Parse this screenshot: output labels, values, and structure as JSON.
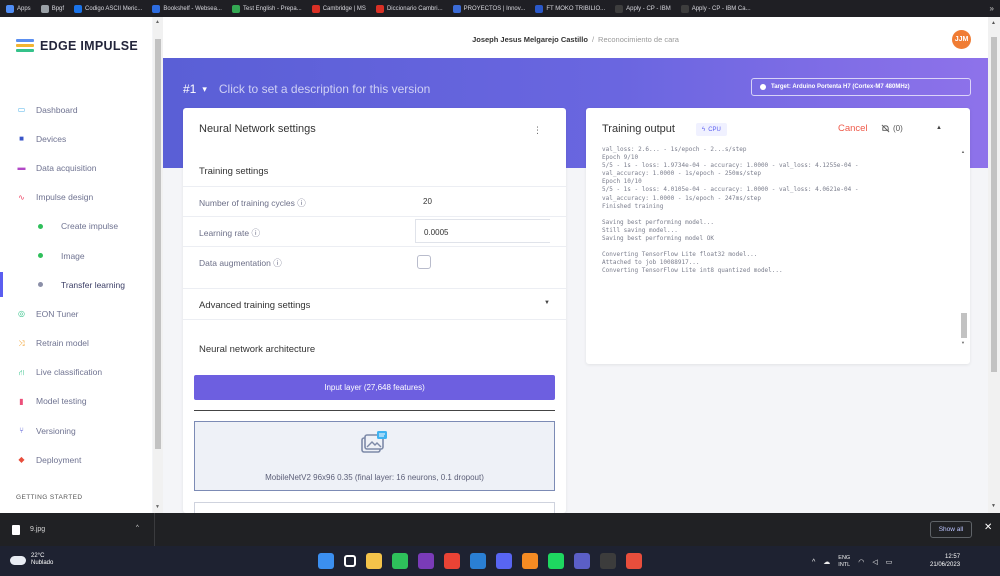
{
  "bookmarks": [
    {
      "label": "Apps",
      "color": "#4f8df5"
    },
    {
      "label": "Bpgf",
      "color": "#9aa0a6"
    },
    {
      "label": "Codigo ASCII Meric...",
      "color": "#1a73e8"
    },
    {
      "label": "Bookshelf - Websea...",
      "color": "#2d6cdf"
    },
    {
      "label": "Test English - Prepa...",
      "color": "#34a853"
    },
    {
      "label": "Cambridge | MS",
      "color": "#d93025"
    },
    {
      "label": "Diccionario Cambri...",
      "color": "#d93025"
    },
    {
      "label": "PROYECTOS | Innov...",
      "color": "#3b6bd6"
    },
    {
      "label": "FT MOKO TRIBILIO...",
      "color": "#2a58c9"
    },
    {
      "label": "Apply - CP - IBM",
      "color": "#3d3d3d"
    },
    {
      "label": "Apply - CP - IBM Ca...",
      "color": "#3d3d3d"
    }
  ],
  "logo": {
    "text": "EDGE IMPULSE"
  },
  "nav": [
    {
      "label": "Dashboard",
      "icon": "monitor-icon",
      "color": "#4fb0e8",
      "glyph": "▭"
    },
    {
      "label": "Devices",
      "icon": "chip-icon",
      "color": "#3a55c8",
      "glyph": "■"
    },
    {
      "label": "Data acquisition",
      "icon": "database-icon",
      "color": "#b248c6",
      "glyph": "▬"
    },
    {
      "label": "Impulse design",
      "icon": "pulse-icon",
      "color": "#ef4a6a",
      "glyph": "∿"
    },
    {
      "label": "Create impulse",
      "sub": true,
      "dot": "#2fbf5b"
    },
    {
      "label": "Image",
      "sub": true,
      "dot": "#2fbf5b"
    },
    {
      "label": "Transfer learning",
      "sub": true,
      "dot": "#8b8fa8",
      "active": true
    },
    {
      "label": "EON Tuner",
      "icon": "tuner-icon",
      "color": "#35c28a",
      "glyph": "◎"
    },
    {
      "label": "Retrain model",
      "icon": "shuffle-icon",
      "color": "#f2a12e",
      "glyph": "⤨"
    },
    {
      "label": "Live classification",
      "icon": "tree-icon",
      "color": "#35c28a",
      "glyph": "⛙"
    },
    {
      "label": "Model testing",
      "icon": "flask-icon",
      "color": "#ec4f7a",
      "glyph": "▮"
    },
    {
      "label": "Versioning",
      "icon": "branch-icon",
      "color": "#5a5fd6",
      "glyph": "⑂"
    },
    {
      "label": "Deployment",
      "icon": "cube-icon",
      "color": "#e84e3c",
      "glyph": "◆"
    }
  ],
  "getting_started": "GETTING STARTED",
  "header": {
    "user": "Joseph Jesus Melgarejo Castillo",
    "separator": "/",
    "project": "Reconocimiento de cara",
    "avatar": "JJM"
  },
  "version": {
    "number": "#1",
    "caret": "▾",
    "description": "Click to set a description for this version"
  },
  "target": {
    "label": "Target: Arduino Portenta H7 (Cortex-M7 480MHz)"
  },
  "nn": {
    "title": "Neural Network settings",
    "menu": "⋮",
    "training_section": "Training settings",
    "cycles_label": "Number of training cycles ⓘ",
    "cycles_value": "20",
    "lr_label": "Learning rate ⓘ",
    "lr_value": "0.0005",
    "aug_label": "Data augmentation ⓘ",
    "aug_checked": false,
    "advanced": "Advanced training settings",
    "advanced_caret": "▼",
    "arch_section": "Neural network architecture",
    "input_layer": "Input layer (27,648 features)",
    "mobilenet": "MobileNetV2 96x96 0.35 (final layer: 16 neurons, 0.1 dropout)"
  },
  "training": {
    "title": "Training output",
    "cpu": "CPU",
    "cancel": "Cancel",
    "bell_count": "(0)",
    "caret": "▲",
    "log": [
      "val_loss: 2.6... - 1s/epoch - 2...s/step",
      "Epoch 9/10",
      "5/5 - 1s - loss: 1.9734e-04 - accuracy: 1.0000 - val_loss: 4.1255e-04 -",
      "val_accuracy: 1.0000 - 1s/epoch - 250ms/step",
      "Epoch 10/10",
      "5/5 - 1s - loss: 4.0105e-04 - accuracy: 1.0000 - val_loss: 4.0621e-04 -",
      "val_accuracy: 1.0000 - 1s/epoch - 247ms/step",
      "Finished training",
      "",
      "Saving best performing model...",
      "Still saving model...",
      "Saving best performing model OK",
      "",
      "Converting TensorFlow Lite float32 model...",
      "Attached to job 10088917...",
      "Converting TensorFlow Lite int8 quantized model..."
    ]
  },
  "downloads": {
    "file": "9.jpg",
    "caret": "^",
    "show_all": "Show all",
    "close": "✕"
  },
  "taskbar": {
    "temp": "22°C",
    "condition": "Nublado",
    "lang_top": "ENG",
    "lang_bottom": "INTL",
    "time": "12:57",
    "date": "21/06/2023"
  },
  "taskbar_apps": [
    {
      "name": "windows-start-icon",
      "color": "#3b8ff0"
    },
    {
      "name": "task-view-icon",
      "color": "#ffffff"
    },
    {
      "name": "file-explorer-icon",
      "color": "#f4c34a"
    },
    {
      "name": "whatsapp-icon",
      "color": "#2ec15b"
    },
    {
      "name": "onenote-icon",
      "color": "#7a3bb8"
    },
    {
      "name": "chrome-icon",
      "color": "#e94335"
    },
    {
      "name": "vscode-icon",
      "color": "#2a7fd4"
    },
    {
      "name": "discord-icon",
      "color": "#5865f2"
    },
    {
      "name": "sublime-icon",
      "color": "#f48b23"
    },
    {
      "name": "spotify-icon",
      "color": "#1ed760"
    },
    {
      "name": "teams-icon",
      "color": "#5b5fc7"
    },
    {
      "name": "terminal-icon",
      "color": "#3c3c3c"
    },
    {
      "name": "snipping-icon",
      "color": "#e84e3c"
    }
  ]
}
